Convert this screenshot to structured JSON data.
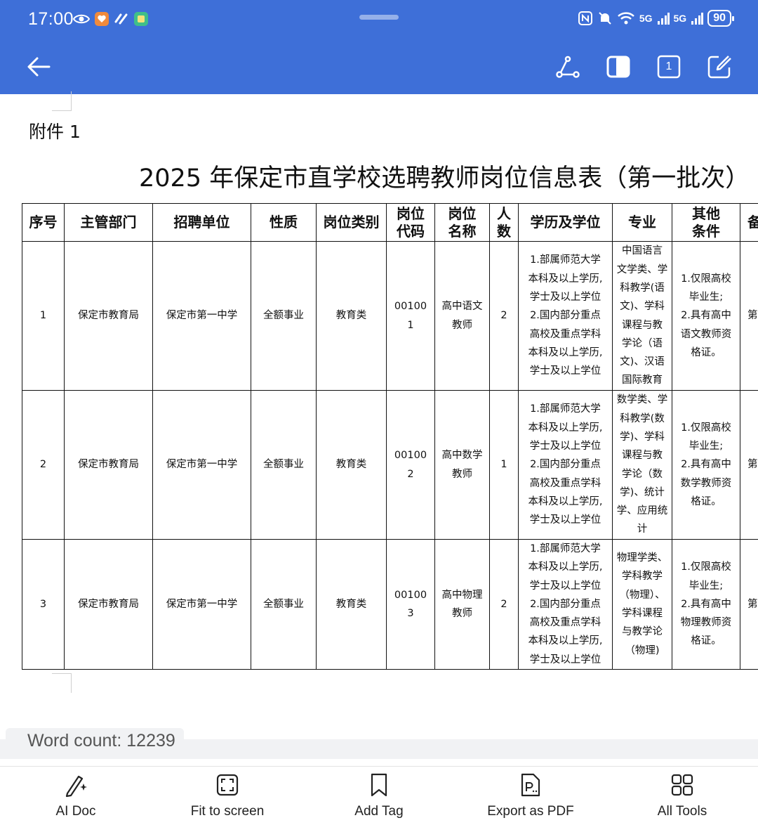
{
  "status_bar": {
    "time": "17:00",
    "battery": "90",
    "network_1": "5G",
    "network_2": "5G"
  },
  "app_bar": {
    "page_indicator": "1",
    "color": "#3e6fd8"
  },
  "document": {
    "attachment_label": "附件 1",
    "title": "2025 年保定市直学校选聘教师岗位信息表（第一批次）",
    "table": {
      "headers": [
        "序号",
        "主管部门",
        "招聘单位",
        "性质",
        "岗位类别",
        "岗位代码",
        "岗位名称",
        "人数",
        "学历及学位",
        "专业",
        "其他条件",
        "备注"
      ],
      "header_lines": {
        "code": [
          "岗位",
          "代码"
        ],
        "name": [
          "岗位",
          "名称"
        ],
        "count": [
          "人",
          "数"
        ],
        "other": [
          "其他",
          "条件"
        ],
        "partial": "备"
      },
      "rows": [
        {
          "seq": "1",
          "dept": "保定市教育局",
          "unit": "保定市第一中学",
          "nature": "全额事业",
          "category": "教育类",
          "code_lines": [
            "00100",
            "1"
          ],
          "name_lines": [
            "高中语文",
            "教师"
          ],
          "count": "2",
          "education_lines": [
            "1.部属师范大学",
            "本科及以上学历,",
            "学士及以上学位",
            "2.国内部分重点",
            "高校及重点学科",
            "本科及以上学历,",
            "学士及以上学位"
          ],
          "major_lines": [
            "中国语言",
            "文学类、学",
            "科教学(语",
            "文)、学科",
            "课程与教",
            "学论（语",
            "文)、汉语",
            "国际教育"
          ],
          "other_lines": [
            "1.仅限高校",
            "毕业生;",
            "2.具有高中",
            "语文教师资",
            "格证。"
          ],
          "partial": "第"
        },
        {
          "seq": "2",
          "dept": "保定市教育局",
          "unit": "保定市第一中学",
          "nature": "全额事业",
          "category": "教育类",
          "code_lines": [
            "00100",
            "2"
          ],
          "name_lines": [
            "高中数学",
            "教师"
          ],
          "count": "1",
          "education_lines": [
            "1.部属师范大学",
            "本科及以上学历,",
            "学士及以上学位",
            "2.国内部分重点",
            "高校及重点学科",
            "本科及以上学历,",
            "学士及以上学位"
          ],
          "major_lines": [
            "数学类、学",
            "科教学(数",
            "学)、学科",
            "课程与教",
            "学论（数",
            "学)、统计",
            "学、应用统",
            "计"
          ],
          "other_lines": [
            "1.仅限高校",
            "毕业生;",
            "2.具有高中",
            "数学教师资",
            "格证。"
          ],
          "partial": "第"
        },
        {
          "seq": "3",
          "dept": "保定市教育局",
          "unit": "保定市第一中学",
          "nature": "全额事业",
          "category": "教育类",
          "code_lines": [
            "00100",
            "3"
          ],
          "name_lines": [
            "高中物理",
            "教师"
          ],
          "count": "2",
          "education_lines": [
            "1.部属师范大学",
            "本科及以上学历,",
            "学士及以上学位",
            "2.国内部分重点",
            "高校及重点学科",
            "本科及以上学历,",
            "学士及以上学位"
          ],
          "major_lines": [
            "物理学类、",
            "学科教学",
            "（物理）、",
            "学科课程",
            "与教学论",
            "（物理)"
          ],
          "other_lines": [
            "1.仅限高校",
            "毕业生;",
            "2.具有高中",
            "物理教师资",
            "格证。"
          ],
          "partial": "第"
        }
      ]
    }
  },
  "word_count": "Word count: 12239",
  "bottom_toolbar": {
    "items": [
      {
        "label": "AI Doc",
        "icon": "ai-doc-icon"
      },
      {
        "label": "Fit to screen",
        "icon": "fit-screen-icon"
      },
      {
        "label": "Add Tag",
        "icon": "bookmark-icon"
      },
      {
        "label": "Export as PDF",
        "icon": "pdf-icon"
      },
      {
        "label": "All Tools",
        "icon": "grid-icon"
      }
    ]
  }
}
